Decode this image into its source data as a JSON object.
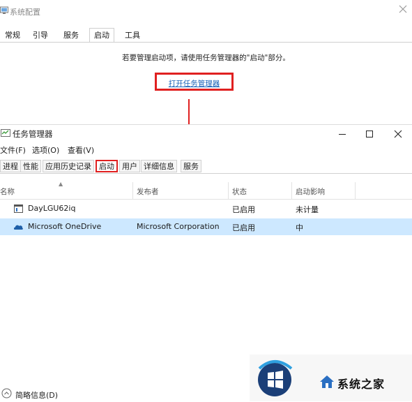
{
  "msconfig": {
    "title": "系统配置",
    "tabs": [
      "常规",
      "引导",
      "服务",
      "启动",
      "工具"
    ],
    "active_tab": "启动",
    "info_text": "若要管理启动项，请使用任务管理器的\"启动\"部分。",
    "open_link": "打开任务管理器"
  },
  "taskmgr": {
    "title": "任务管理器",
    "menu": [
      "文件(F)",
      "选项(O)",
      "查看(V)"
    ],
    "tabs": [
      "进程",
      "性能",
      "应用历史记录",
      "启动",
      "用户",
      "详细信息",
      "服务"
    ],
    "active_tab": "启动",
    "columns": [
      "名称",
      "发布者",
      "状态",
      "启动影响"
    ],
    "rows": [
      {
        "name": "DayLGU62iq",
        "publisher": "",
        "status": "已启用",
        "impact": "未计量",
        "icon": "app-window-icon"
      },
      {
        "name": "Microsoft OneDrive",
        "publisher": "Microsoft Corporation",
        "status": "已启用",
        "impact": "中",
        "icon": "onedrive-cloud-icon",
        "selected": true
      }
    ],
    "footer": "简略信息(D)"
  },
  "watermark": {
    "text": "系统之家"
  },
  "colors": {
    "highlight_red": "#e02020",
    "link_blue": "#1a63b8",
    "selection_blue": "#cde8ff"
  }
}
